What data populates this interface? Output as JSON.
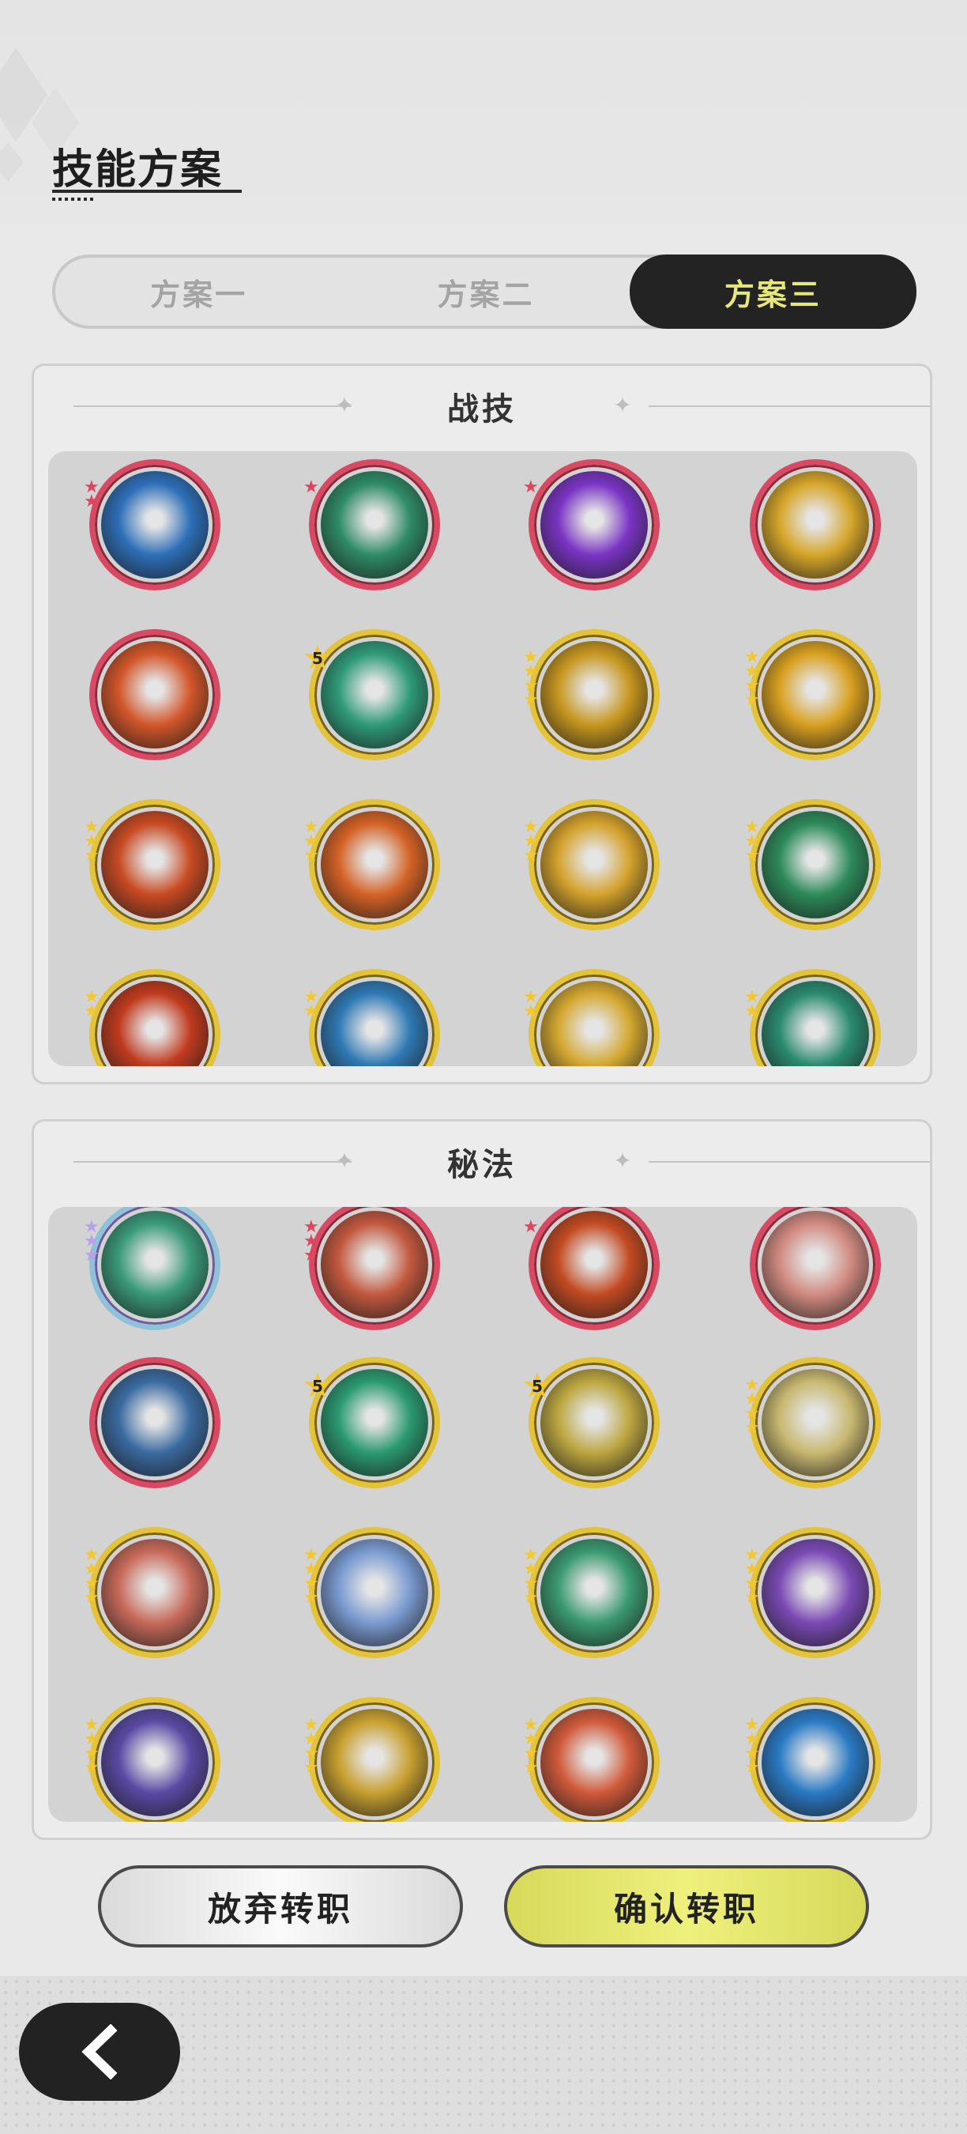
{
  "header": {
    "title": "技能方案"
  },
  "tabs": [
    {
      "label": "方案一",
      "active": false
    },
    {
      "label": "方案二",
      "active": false
    },
    {
      "label": "方案三",
      "active": true
    }
  ],
  "battle_skills": {
    "title": "战技",
    "icons": [
      {
        "frame": "red",
        "stars": 2,
        "star_color": "red",
        "icon": "water-wave-icon",
        "color": "#2d6fb8"
      },
      {
        "frame": "red",
        "stars": 1,
        "star_color": "red",
        "icon": "wind-swirl-icon",
        "color": "#2e8b66"
      },
      {
        "frame": "red",
        "stars": 1,
        "star_color": "red",
        "icon": "arcane-burst-icon",
        "color": "#7a34c4"
      },
      {
        "frame": "red",
        "stars": 0,
        "star_color": "red",
        "icon": "light-burst-icon",
        "color": "#d6a62a"
      },
      {
        "frame": "red",
        "stars": 0,
        "star_color": "red",
        "icon": "fire-explosion-icon",
        "color": "#d2562a"
      },
      {
        "frame": "gold",
        "stars": 5,
        "star_color": "gold",
        "icon": "wind-vortex-icon",
        "color": "#2e9a78",
        "numbered": "5"
      },
      {
        "frame": "gold",
        "stars": 4,
        "star_color": "gold",
        "icon": "holy-crystal-icon",
        "color": "#c6961e"
      },
      {
        "frame": "gold",
        "stars": 4,
        "star_color": "gold",
        "icon": "holy-figure-icon",
        "color": "#d8a020"
      },
      {
        "frame": "gold",
        "stars": 3,
        "star_color": "gold",
        "icon": "fire-swirl-icon",
        "color": "#c84a22"
      },
      {
        "frame": "gold",
        "stars": 3,
        "star_color": "gold",
        "icon": "flame-wave-icon",
        "color": "#d46226"
      },
      {
        "frame": "gold",
        "stars": 3,
        "star_color": "gold",
        "icon": "light-spike-icon",
        "color": "#d4a22c"
      },
      {
        "frame": "gold",
        "stars": 3,
        "star_color": "gold",
        "icon": "heal-cross-icon",
        "color": "#2c8a5a"
      },
      {
        "frame": "gold",
        "stars": 2,
        "star_color": "gold",
        "icon": "fire-pillar-icon",
        "color": "#c03a1e"
      },
      {
        "frame": "gold",
        "stars": 2,
        "star_color": "gold",
        "icon": "water-splash-icon",
        "color": "#2f79b4"
      },
      {
        "frame": "gold",
        "stars": 2,
        "star_color": "gold",
        "icon": "light-flare-icon",
        "color": "#d4a830"
      },
      {
        "frame": "gold",
        "stars": 2,
        "star_color": "gold",
        "icon": "wind-blade-icon",
        "color": "#2a8a70"
      }
    ]
  },
  "secret_arts": {
    "title": "秘法",
    "icons": [
      {
        "frame": "rainbow",
        "stars": 3,
        "star_color": "purple",
        "icon": "nature-burst-icon",
        "color": "#3a9a7a"
      },
      {
        "frame": "red",
        "stars": 3,
        "star_color": "red",
        "icon": "demon-face-icon",
        "color": "#c2583e"
      },
      {
        "frame": "red",
        "stars": 1,
        "star_color": "red",
        "icon": "fire-orb-icon",
        "color": "#c24a22"
      },
      {
        "frame": "red",
        "stars": 0,
        "star_color": "red",
        "icon": "heal-figure-icon",
        "color": "#d08a80"
      },
      {
        "frame": "red",
        "stars": 0,
        "star_color": "red",
        "icon": "ice-crystal-icon",
        "color": "#3a6aa0"
      },
      {
        "frame": "gold",
        "stars": 5,
        "star_color": "gold",
        "icon": "spirit-figure-icon",
        "color": "#2a9a70",
        "numbered": "5"
      },
      {
        "frame": "gold",
        "stars": 5,
        "star_color": "gold",
        "icon": "shield-icon",
        "color": "#bca640",
        "numbered": "5"
      },
      {
        "frame": "gold",
        "stars": 4,
        "star_color": "gold",
        "icon": "guardian-figure-icon",
        "color": "#c8b870"
      },
      {
        "frame": "gold",
        "stars": 4,
        "star_color": "gold",
        "icon": "crimson-wave-icon",
        "color": "#c86a5a"
      },
      {
        "frame": "gold",
        "stars": 4,
        "star_color": "gold",
        "icon": "star-spark-icon",
        "color": "#7a9ad0"
      },
      {
        "frame": "gold",
        "stars": 4,
        "star_color": "gold",
        "icon": "heart-icon",
        "color": "#3a9a70"
      },
      {
        "frame": "gold",
        "stars": 4,
        "star_color": "gold",
        "icon": "spiral-icon",
        "color": "#7a4ab4"
      },
      {
        "frame": "gold",
        "stars": 4,
        "star_color": "gold",
        "icon": "magic-circle-icon",
        "color": "#5a4aa4"
      },
      {
        "frame": "gold",
        "stars": 4,
        "star_color": "gold",
        "icon": "light-star-icon",
        "color": "#c8a030"
      },
      {
        "frame": "gold",
        "stars": 4,
        "star_color": "gold",
        "icon": "fire-figure-icon",
        "color": "#d05a3a"
      },
      {
        "frame": "gold",
        "stars": 4,
        "star_color": "gold",
        "icon": "water-figure-icon",
        "color": "#2a7ac4"
      }
    ]
  },
  "buttons": {
    "abandon": "放弃转职",
    "confirm": "确认转职"
  },
  "colors": {
    "active_tab_bg": "#232323",
    "active_tab_text": "#e6e97a",
    "confirm_button": "#e6e97a"
  }
}
